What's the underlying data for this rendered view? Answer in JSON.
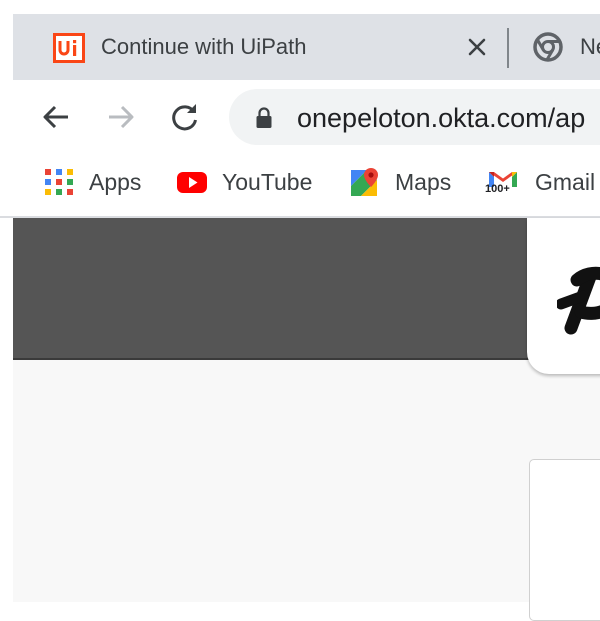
{
  "browser": {
    "tabs": [
      {
        "title": "Continue with UiPath",
        "favicon": "uipath-icon"
      },
      {
        "title": "Ne",
        "favicon": "chrome-icon"
      }
    ],
    "address": {
      "url": "onepeloton.okta.com/ap",
      "security_icon": "lock-icon"
    },
    "bookmarks": [
      {
        "label": "Apps",
        "icon": "apps-grid-icon"
      },
      {
        "label": "YouTube",
        "icon": "youtube-icon"
      },
      {
        "label": "Maps",
        "icon": "maps-icon"
      },
      {
        "label": "Gmail",
        "icon": "gmail-icon",
        "badge": "100+"
      }
    ]
  },
  "page": {
    "brand_logo": "peloton-logo",
    "colors": {
      "header": "#555555",
      "background": "#f8f8f8"
    }
  }
}
